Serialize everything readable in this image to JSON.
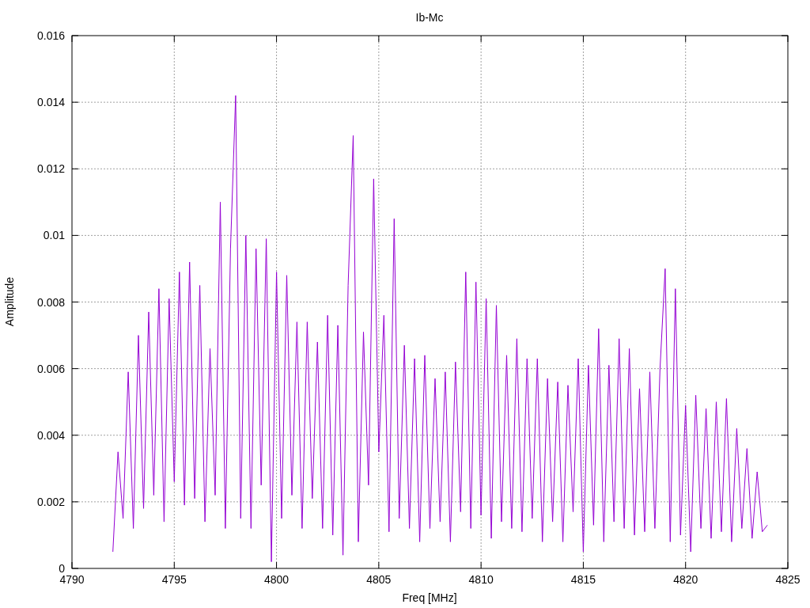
{
  "chart_data": {
    "type": "line",
    "title": "Ib-Mc",
    "xlabel": "Freq [MHz]",
    "ylabel": "Amplitude",
    "xlim": [
      4790,
      4825
    ],
    "ylim": [
      0,
      0.016
    ],
    "grid": true,
    "xticks": [
      {
        "value": 4790,
        "label": "4790"
      },
      {
        "value": 4795,
        "label": "4795"
      },
      {
        "value": 4800,
        "label": "4800"
      },
      {
        "value": 4805,
        "label": "4805"
      },
      {
        "value": 4810,
        "label": "4810"
      },
      {
        "value": 4815,
        "label": "4815"
      },
      {
        "value": 4820,
        "label": "4820"
      },
      {
        "value": 4825,
        "label": "4825"
      }
    ],
    "yticks": [
      {
        "value": 0,
        "label": "0"
      },
      {
        "value": 0.002,
        "label": "0.002"
      },
      {
        "value": 0.004,
        "label": "0.004"
      },
      {
        "value": 0.006,
        "label": "0.006"
      },
      {
        "value": 0.008,
        "label": "0.008"
      },
      {
        "value": 0.01,
        "label": "0.01"
      },
      {
        "value": 0.012,
        "label": "0.012"
      },
      {
        "value": 0.014,
        "label": "0.014"
      },
      {
        "value": 0.016,
        "label": "0.016"
      }
    ],
    "x": [
      4792,
      4792.25,
      4792.5,
      4792.75,
      4793,
      4793.25,
      4793.5,
      4793.75,
      4794,
      4794.25,
      4794.5,
      4794.75,
      4795,
      4795.25,
      4795.5,
      4795.75,
      4796,
      4796.25,
      4796.5,
      4796.75,
      4797,
      4797.25,
      4797.5,
      4797.75,
      4798,
      4798.25,
      4798.5,
      4798.75,
      4799,
      4799.25,
      4799.5,
      4799.75,
      4800,
      4800.25,
      4800.5,
      4800.75,
      4801,
      4801.25,
      4801.5,
      4801.75,
      4802,
      4802.25,
      4802.5,
      4802.75,
      4803,
      4803.25,
      4803.5,
      4803.75,
      4804,
      4804.25,
      4804.5,
      4804.75,
      4805,
      4805.25,
      4805.5,
      4805.75,
      4806,
      4806.25,
      4806.5,
      4806.75,
      4807,
      4807.25,
      4807.5,
      4807.75,
      4808,
      4808.25,
      4808.5,
      4808.75,
      4809,
      4809.25,
      4809.5,
      4809.75,
      4810,
      4810.25,
      4810.5,
      4810.75,
      4811,
      4811.25,
      4811.5,
      4811.75,
      4812,
      4812.25,
      4812.5,
      4812.75,
      4813,
      4813.25,
      4813.5,
      4813.75,
      4814,
      4814.25,
      4814.5,
      4814.75,
      4815,
      4815.25,
      4815.5,
      4815.75,
      4816,
      4816.25,
      4816.5,
      4816.75,
      4817,
      4817.25,
      4817.5,
      4817.75,
      4818,
      4818.25,
      4818.5,
      4818.75,
      4819,
      4819.25,
      4819.5,
      4819.75,
      4820,
      4820.25,
      4820.5,
      4820.75,
      4821,
      4821.25,
      4821.5,
      4821.75,
      4822,
      4822.25,
      4822.5,
      4822.75,
      4823,
      4823.25,
      4823.5,
      4823.75,
      4824
    ],
    "series": [
      {
        "color": "#9400d3",
        "values": [
          0.0005,
          0.0035,
          0.0015,
          0.0059,
          0.0012,
          0.007,
          0.0018,
          0.0077,
          0.0022,
          0.0084,
          0.0014,
          0.0081,
          0.0026,
          0.0089,
          0.0019,
          0.0092,
          0.0021,
          0.0085,
          0.0014,
          0.0066,
          0.0022,
          0.011,
          0.0012,
          0.0096,
          0.0142,
          0.0015,
          0.01,
          0.0012,
          0.0096,
          0.0025,
          0.0099,
          0.0002,
          0.0089,
          0.0015,
          0.0088,
          0.0022,
          0.0074,
          0.0012,
          0.0074,
          0.0021,
          0.0068,
          0.0012,
          0.0076,
          0.001,
          0.0073,
          0.0004,
          0.0085,
          0.013,
          0.0008,
          0.0071,
          0.0025,
          0.0117,
          0.0035,
          0.0076,
          0.0011,
          0.0105,
          0.0015,
          0.0067,
          0.0012,
          0.0063,
          0.0008,
          0.0064,
          0.0012,
          0.0057,
          0.0014,
          0.0059,
          0.0008,
          0.0062,
          0.0017,
          0.0089,
          0.0012,
          0.0086,
          0.0016,
          0.0081,
          0.0009,
          0.0079,
          0.0014,
          0.0064,
          0.0012,
          0.0069,
          0.0011,
          0.0063,
          0.0015,
          0.0063,
          0.0008,
          0.0057,
          0.0014,
          0.0056,
          0.0008,
          0.0055,
          0.0017,
          0.0063,
          0.0005,
          0.0061,
          0.0013,
          0.0072,
          0.0008,
          0.0061,
          0.0014,
          0.0069,
          0.0012,
          0.0066,
          0.001,
          0.0054,
          0.0011,
          0.0059,
          0.0012,
          0.006,
          0.009,
          0.0008,
          0.0084,
          0.001,
          0.0049,
          0.0005,
          0.0052,
          0.0012,
          0.0048,
          0.0009,
          0.005,
          0.0011,
          0.0051,
          0.0008,
          0.0042,
          0.0012,
          0.0036,
          0.0009,
          0.0029,
          0.0011,
          0.0013
        ]
      }
    ]
  }
}
